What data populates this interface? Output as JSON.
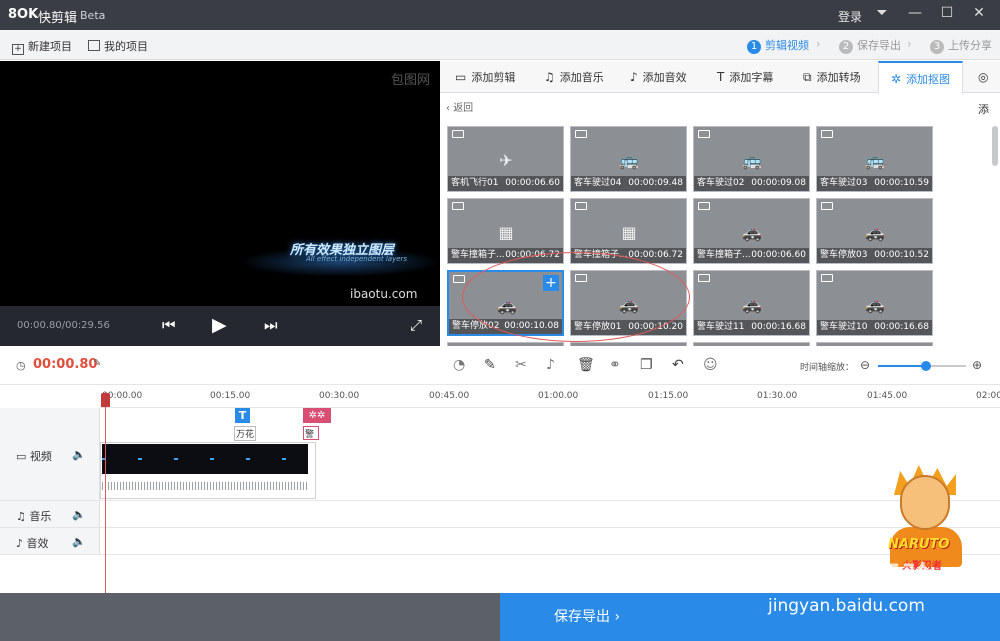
{
  "title_bar": {
    "logo": "8OK",
    "app_name": "快剪辑",
    "version": "Beta",
    "login": "登录"
  },
  "toolbar": {
    "new_project": "新建项目",
    "my_projects": "我的项目"
  },
  "steps": [
    {
      "num": "1",
      "label": "剪辑视频"
    },
    {
      "num": "2",
      "label": "保存导出"
    },
    {
      "num": "3",
      "label": "上传分享"
    }
  ],
  "preview": {
    "watermark": "包图网",
    "text_cn": "所有效果独立图层",
    "text_en": "All effect independent layers",
    "url": "ibaotu.com",
    "time": "00:00.80/00:29.56"
  },
  "tabs": [
    {
      "icon": "▭",
      "label": "添加剪辑"
    },
    {
      "icon": "♫",
      "label": "添加音乐"
    },
    {
      "icon": "♪",
      "label": "添加音效"
    },
    {
      "icon": "T",
      "label": "添加字幕"
    },
    {
      "icon": "⧉",
      "label": "添加转场"
    },
    {
      "icon": "✲",
      "label": "添加抠图"
    },
    {
      "icon": "◎",
      "label": "添"
    }
  ],
  "back_label": "返回",
  "clips": [
    {
      "name": "客机飞行01",
      "dur": "00:00:06.60",
      "icon": "✈"
    },
    {
      "name": "客车驶过04",
      "dur": "00:00:09.48",
      "icon": "🚌"
    },
    {
      "name": "客车驶过02",
      "dur": "00:00:09.08",
      "icon": "🚌"
    },
    {
      "name": "客车驶过03",
      "dur": "00:00:10.59",
      "icon": "🚌"
    },
    {
      "name": "警车撞箱子...",
      "dur": "00:00:06.72",
      "icon": "▦"
    },
    {
      "name": "警车撞箱子...",
      "dur": "00:00:06.72",
      "icon": "▦"
    },
    {
      "name": "警车撞箱子...",
      "dur": "00:00:06.60",
      "icon": "🚓"
    },
    {
      "name": "警车停放03",
      "dur": "00:00:10.52",
      "icon": "🚓"
    },
    {
      "name": "警车停放02",
      "dur": "00:00:10.08",
      "icon": "🚓"
    },
    {
      "name": "警车停放01",
      "dur": "00:00:10.20",
      "icon": "🚓"
    },
    {
      "name": "警车驶过11",
      "dur": "00:00:16.68",
      "icon": "🚓"
    },
    {
      "name": "警车驶过10",
      "dur": "00:00:16.68",
      "icon": "🚓"
    }
  ],
  "timeline": {
    "current_time": "00:00.80",
    "zoom_label": "时间轴缩放：",
    "zoom_level": 0.55,
    "ticks": [
      "00:00.00",
      "00:15.00",
      "00:30.00",
      "00:45.00",
      "01:00.00",
      "01:15.00",
      "01:30.00",
      "01:45.00",
      "02:00"
    ],
    "subtitle_clip": "万花",
    "sticker_clip": "警车"
  },
  "tracks": [
    {
      "icon": "▭",
      "label": "视频"
    },
    {
      "icon": "♫",
      "label": "音乐"
    },
    {
      "icon": "♪",
      "label": "音效"
    }
  ],
  "footer": {
    "save_export": "保存导出"
  },
  "overlay": {
    "naruto": "NARUTO",
    "naruto_sub": "火影忍者",
    "baidu": "Baidu经验",
    "jingyan": "jingyan.baidu.com"
  },
  "colors": {
    "accent": "#2a8ae8",
    "title_bg": "#3a3d44",
    "time_red": "#e24e3c"
  }
}
